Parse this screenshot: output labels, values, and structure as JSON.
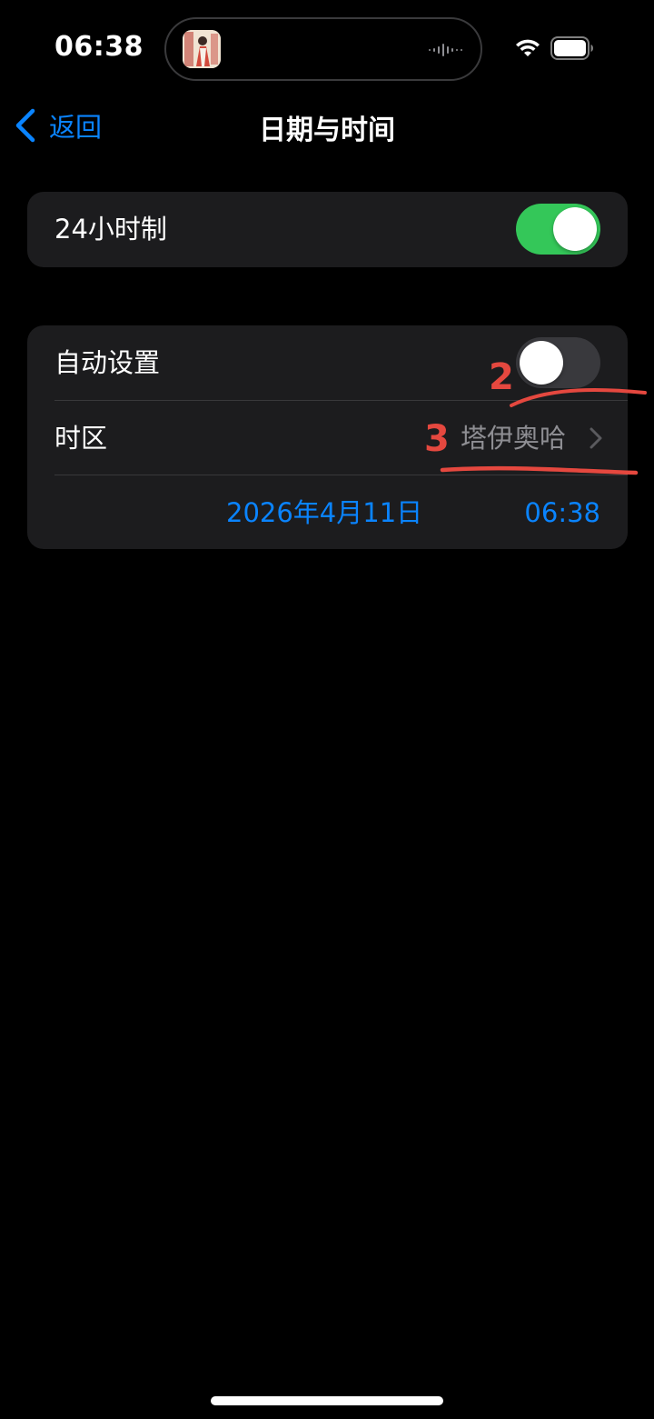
{
  "status_bar": {
    "time": "06:38",
    "island_app_icon": "app-thumbnail-icon",
    "indicator_icons": [
      "waveform-icon",
      "wifi-icon",
      "battery-icon"
    ]
  },
  "nav": {
    "back_label": "返回",
    "back_icon": "chevron-left-icon",
    "title": "日期与时间"
  },
  "settings": {
    "clock_24h": {
      "label": "24小时制",
      "enabled": true
    },
    "auto_set": {
      "label": "自动设置",
      "enabled": false
    },
    "time_zone": {
      "label": "时区",
      "value": "塔伊奥哈",
      "chevron_icon": "chevron-right-icon"
    },
    "date": "2026年4月11日",
    "time": "06:38"
  },
  "annotations": {
    "step_2": "2",
    "step_3": "3"
  },
  "colors": {
    "background": "#000000",
    "group_background": "#1c1c1e",
    "accent_blue": "#0a84ff",
    "toggle_on_green": "#34c759",
    "toggle_off_gray": "#39393d",
    "secondary_text": "#8e8e93",
    "annotation_red": "#e5483f"
  }
}
